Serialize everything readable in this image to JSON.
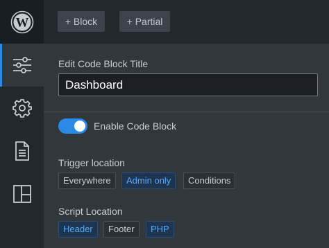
{
  "sidebar": {
    "logo_icon": "wordpress-logo-icon",
    "items": [
      {
        "icon": "sliders-icon",
        "active": true
      },
      {
        "icon": "gear-icon",
        "active": false
      },
      {
        "icon": "document-icon",
        "active": false
      },
      {
        "icon": "layout-icon",
        "active": false
      }
    ]
  },
  "toolbar": {
    "block_label": "+ Block",
    "partial_label": "+ Partial"
  },
  "editor": {
    "title_label": "Edit Code Block Title",
    "title_value": "Dashboard",
    "enable_label": "Enable Code Block",
    "enable_on": true,
    "trigger_label": "Trigger location",
    "trigger_options": [
      "Everywhere",
      "Admin only",
      "Conditions"
    ],
    "trigger_selected": "Admin only",
    "script_label": "Script Location",
    "script_options": [
      "Header",
      "Footer",
      "PHP"
    ],
    "script_selected": [
      "Header",
      "PHP"
    ]
  },
  "colors": {
    "accent": "#2b89e8",
    "selected_text": "#56a9f7",
    "panel_bg": "#32373c",
    "sidebar_bg": "#23282d"
  }
}
